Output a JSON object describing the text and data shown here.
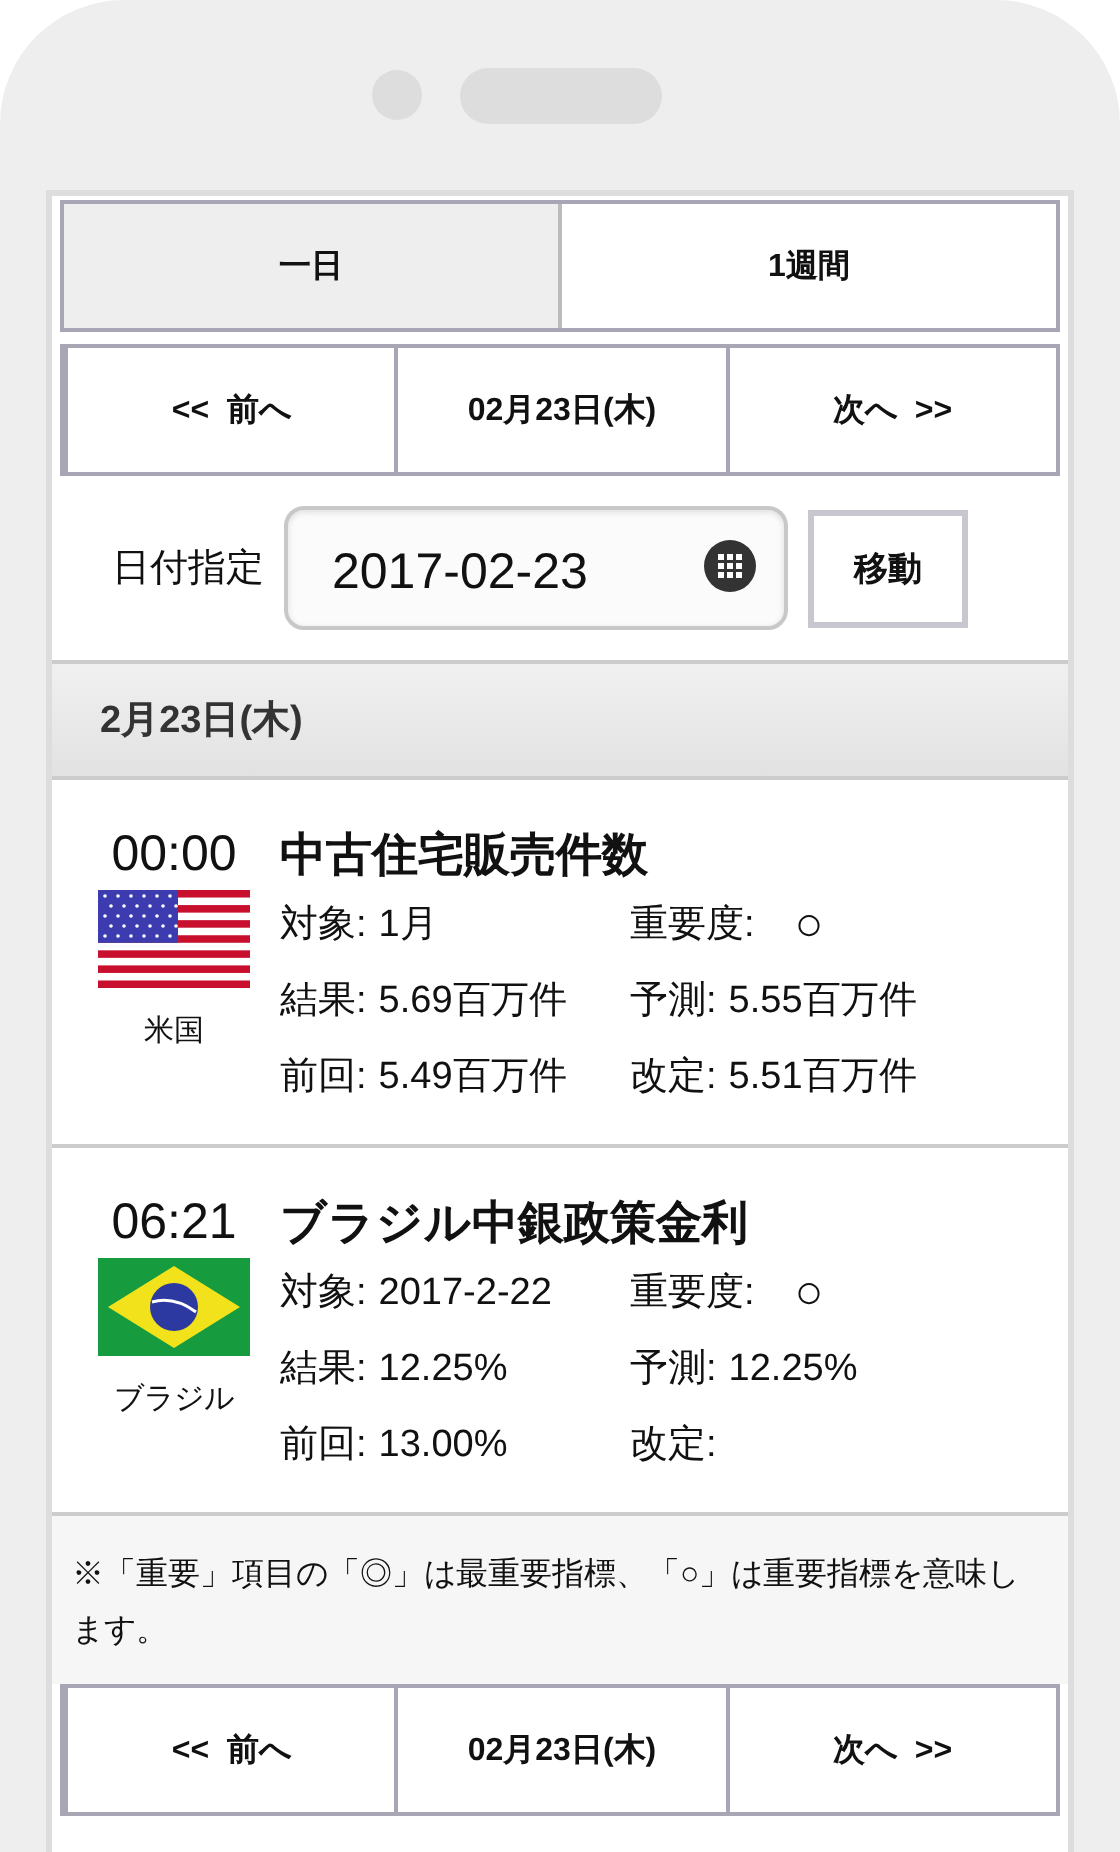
{
  "tabs": [
    {
      "label": "一日",
      "selected": true
    },
    {
      "label": "1週間",
      "selected": false
    }
  ],
  "top_nav": {
    "prev": "<<  前へ",
    "date": "02月23日(木)",
    "next": "次へ  >>"
  },
  "date_picker": {
    "label": "日付指定",
    "value": "2017-02-23",
    "button": "移動"
  },
  "day_header": "2月23日(木)",
  "events": [
    {
      "time": "00:00",
      "kind": "us",
      "country": "米国",
      "title": "中古住宅販売件数",
      "details": [
        {
          "label": "対象:",
          "value": "1月"
        },
        {
          "label": "重要度:",
          "value": "○"
        },
        {
          "label": "結果:",
          "value": "5.69百万件"
        },
        {
          "label": "予測:",
          "value": "5.55百万件"
        },
        {
          "label": "前回:",
          "value": "5.49百万件"
        },
        {
          "label": "改定:",
          "value": "5.51百万件"
        }
      ]
    },
    {
      "time": "06:21",
      "kind": "br",
      "country": "ブラジル",
      "title": "ブラジル中銀政策金利",
      "details": [
        {
          "label": "対象:",
          "value": "2017-2-22"
        },
        {
          "label": "重要度:",
          "value": "○"
        },
        {
          "label": "結果:",
          "value": "12.25%"
        },
        {
          "label": "予測:",
          "value": "12.25%"
        },
        {
          "label": "前回:",
          "value": "13.00%"
        },
        {
          "label": "改定:"
        }
      ]
    }
  ],
  "note": "※「重要」項目の「◎」は最重要指標、「○」は重要指標を意味します。",
  "bottom_nav": {
    "prev": "<<  前へ",
    "date": "02月23日(木)",
    "next": "次へ  >>"
  }
}
